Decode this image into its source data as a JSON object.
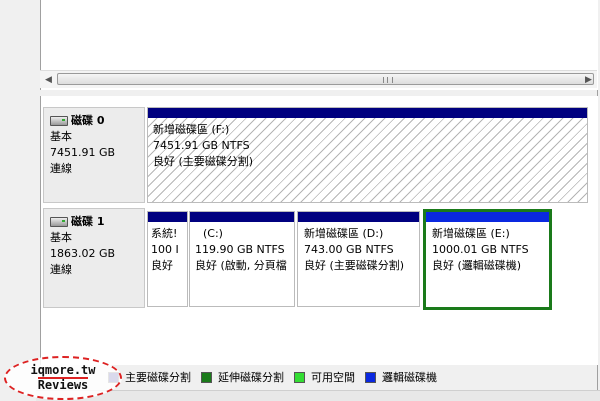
{
  "disks": [
    {
      "name": "磁碟 0",
      "type": "基本",
      "size": "7451.91 GB",
      "status": "連線",
      "partitions": [
        {
          "name": "新增磁碟區  (F:)",
          "size": "7451.91 GB NTFS",
          "status": "良好 (主要磁碟分割)"
        }
      ]
    },
    {
      "name": "磁碟 1",
      "type": "基本",
      "size": "1863.02 GB",
      "status": "連線",
      "partitions": [
        {
          "name": "系統!",
          "size": "100 I",
          "status": "良好"
        },
        {
          "name": "(C:)",
          "size": "119.90 GB NTFS",
          "status": "良好 (啟動, 分頁檔"
        },
        {
          "name": "新增磁碟區  (D:)",
          "size": "743.00 GB NTFS",
          "status": "良好 (主要磁碟分割)"
        },
        {
          "name": "新增磁碟區  (E:)",
          "size": "1000.01 GB NTFS",
          "status": "良好 (邏輯磁碟機)"
        }
      ]
    }
  ],
  "legend": [
    {
      "label": "主要磁碟分割",
      "color": "#00007f"
    },
    {
      "label": "延伸磁碟分割",
      "color": "#1a7a1a"
    },
    {
      "label": "可用空間",
      "color": "#33dd33"
    },
    {
      "label": "邏輯磁碟機",
      "color": "#0a28e0"
    }
  ],
  "watermark": {
    "line1": "iqmore.tw",
    "line2": "Reviews"
  },
  "colors": {
    "primary_partition": "#00007f",
    "extended_partition": "#1a7a1a",
    "free_space": "#33dd33",
    "logical_drive": "#0a28e0"
  },
  "icons": {
    "disk": "disk-drive-icon",
    "scroll_left": "arrow-left-icon",
    "scroll_right": "arrow-right-icon"
  }
}
